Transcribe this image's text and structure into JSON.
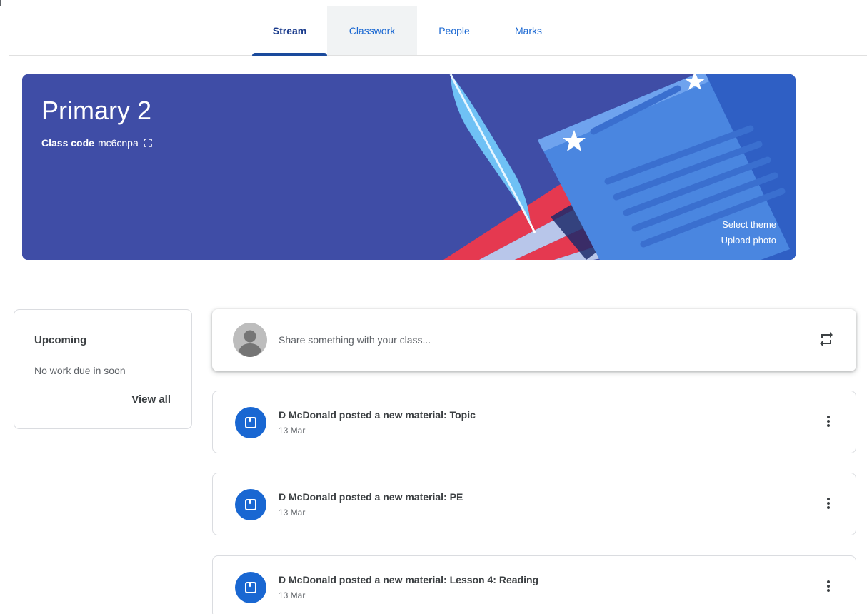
{
  "tabs": [
    {
      "label": "Stream",
      "active": true
    },
    {
      "label": "Classwork",
      "active": false
    },
    {
      "label": "People",
      "active": false
    },
    {
      "label": "Marks",
      "active": false
    }
  ],
  "banner": {
    "title": "Primary 2",
    "class_code_label": "Class code",
    "class_code": "mc6cnpa",
    "select_theme": "Select theme",
    "upload_photo": "Upload photo",
    "bg_color": "#3f4da6"
  },
  "upcoming": {
    "title": "Upcoming",
    "empty_text": "No work due in soon",
    "view_all": "View all"
  },
  "share": {
    "placeholder": "Share something with your class..."
  },
  "posts": [
    {
      "title": "D McDonald posted a new material: Topic",
      "date": "13 Mar",
      "icon": "material-icon"
    },
    {
      "title": "D McDonald posted a new material: PE",
      "date": "13 Mar",
      "icon": "material-icon"
    },
    {
      "title": "D McDonald posted a new material: Lesson 4: Reading",
      "date": "13 Mar",
      "icon": "material-icon"
    }
  ],
  "colors": {
    "accent": "#1967d2",
    "tab_active": "#1a3b8c"
  }
}
